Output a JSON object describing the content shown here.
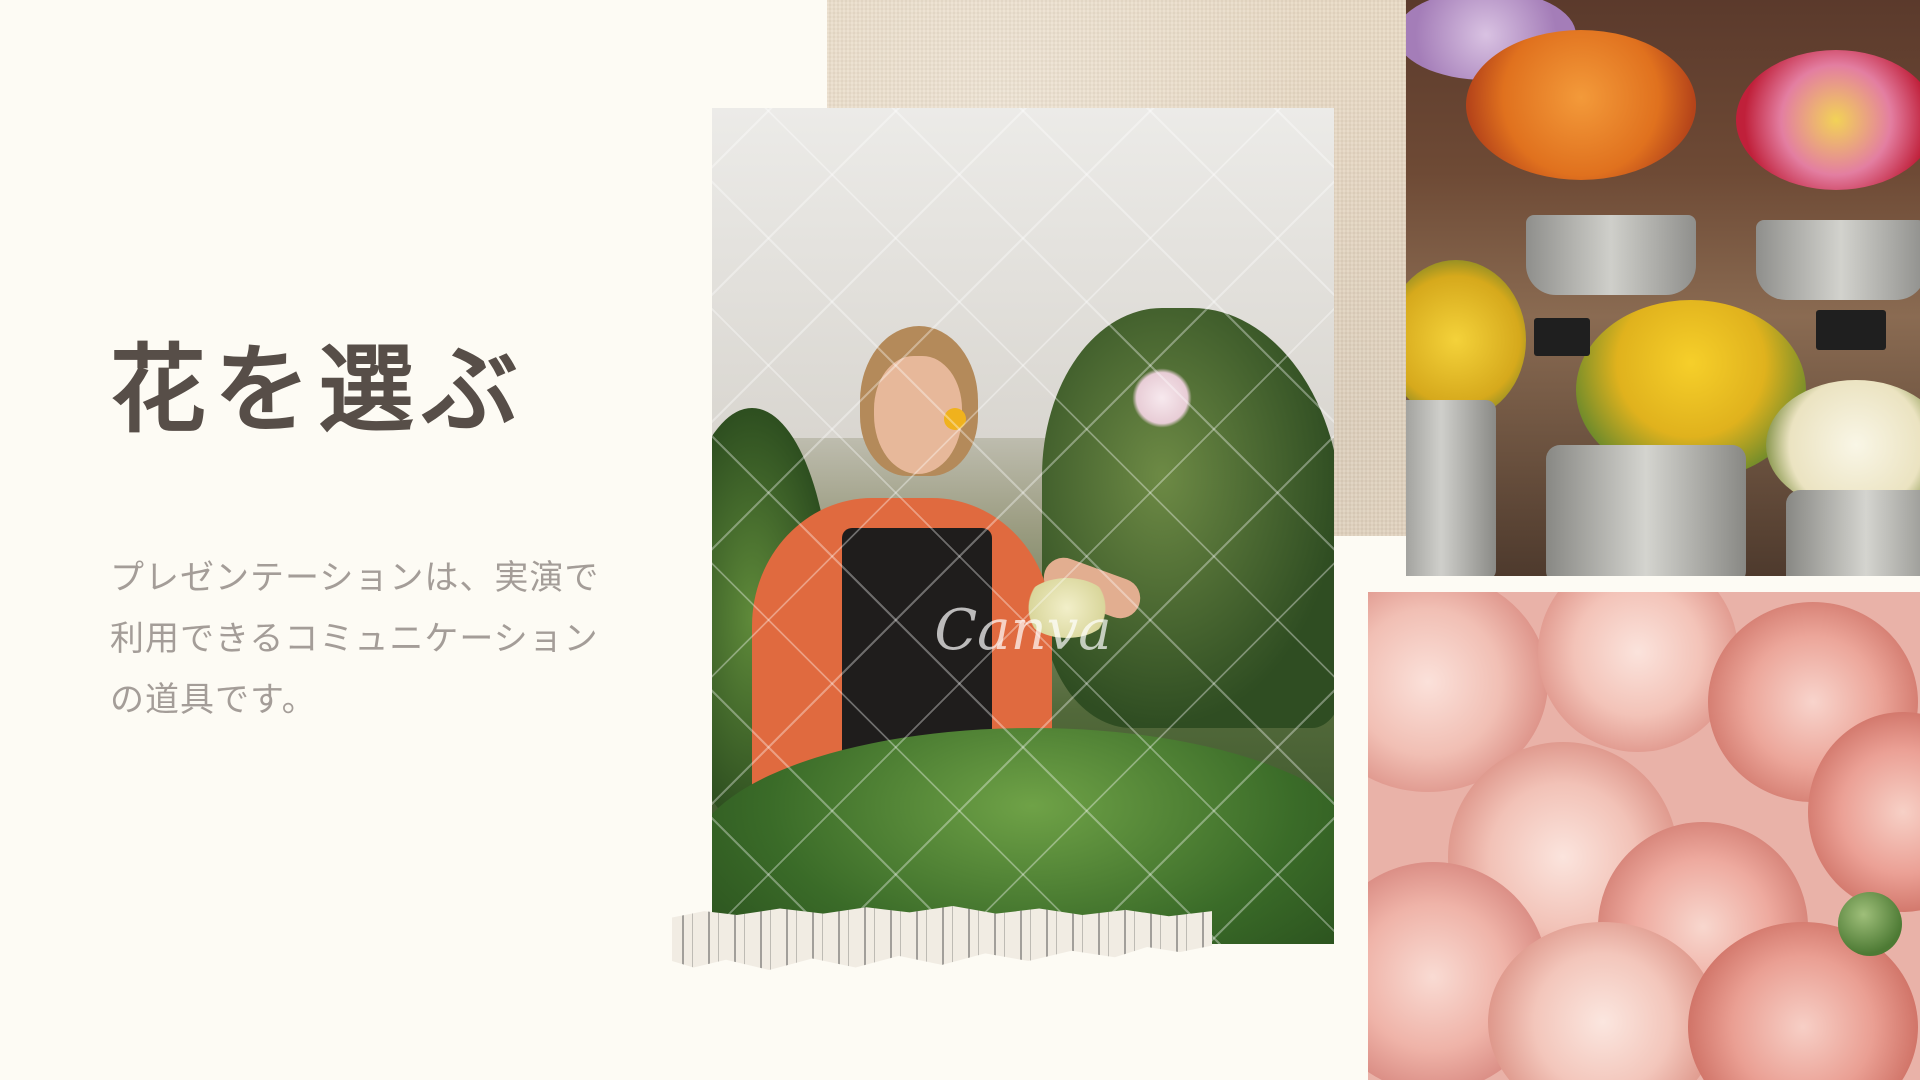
{
  "slide": {
    "title": "花を選ぶ",
    "body": "プレゼンテーションは、実演で利用できるコミュニケーションの道具です。",
    "watermark": "Canva"
  },
  "colors": {
    "background": "#fdfbf4",
    "title": "#574e48",
    "body": "#a49d98",
    "paper": "#e8d9c4"
  }
}
